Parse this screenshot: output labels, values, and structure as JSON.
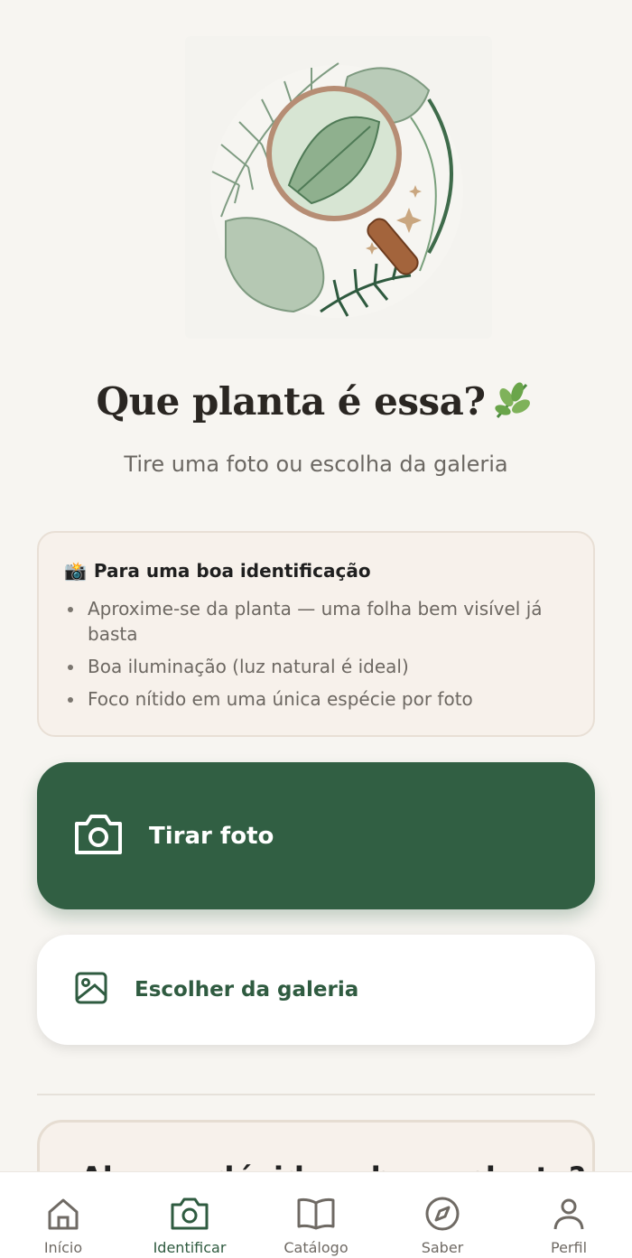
{
  "hero": {
    "title": "Que planta é essa?",
    "subtitle": "Tire uma foto ou escolha da galeria"
  },
  "tips": {
    "emoji": "📸",
    "title": "Para uma boa identificação",
    "items": [
      "Aproxime-se da planta — uma folha bem visível já basta",
      "Boa iluminação (luz natural é ideal)",
      "Foco nítido em uma única espécie por foto"
    ]
  },
  "actions": {
    "take_photo": "Tirar foto",
    "choose_gallery": "Escolher da galeria"
  },
  "peek": {
    "title": "Alguma dúvida sobre a planta?"
  },
  "nav": {
    "items": [
      {
        "label": "Início",
        "icon": "home-icon"
      },
      {
        "label": "Identificar",
        "icon": "camera-icon",
        "active": true
      },
      {
        "label": "Catálogo",
        "icon": "book-icon"
      },
      {
        "label": "Saber",
        "icon": "compass-icon"
      },
      {
        "label": "Perfil",
        "icon": "user-icon"
      }
    ]
  },
  "colors": {
    "primary": "#315f43",
    "background": "#f7f5f1",
    "card": "#f7f1eb"
  }
}
